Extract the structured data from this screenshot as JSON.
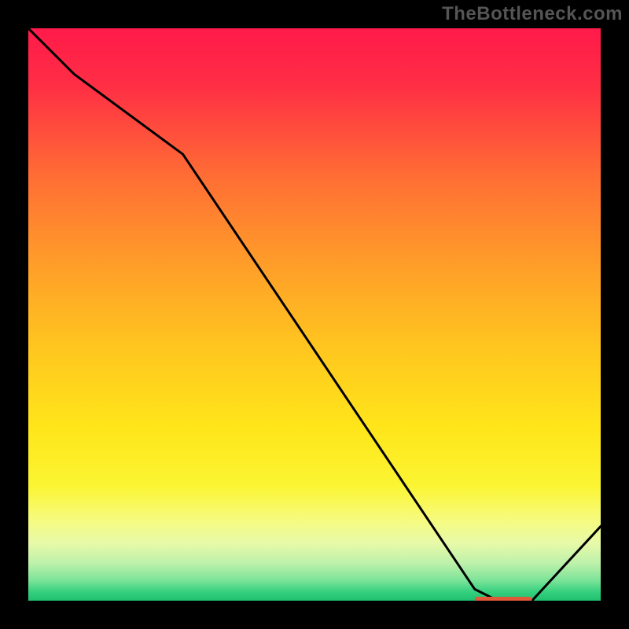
{
  "watermark": "TheBottleneck.com",
  "chart_data": {
    "type": "line",
    "title": "",
    "xlabel": "",
    "ylabel": "",
    "xlim": [
      0,
      100
    ],
    "ylim": [
      0,
      100
    ],
    "grid": false,
    "series": [
      {
        "name": "bottleneck-curve",
        "color": "#000000",
        "x": [
          0,
          8,
          27,
          78,
          82,
          88,
          100
        ],
        "y": [
          100,
          92,
          78,
          2,
          0,
          0,
          13
        ]
      }
    ],
    "optimal_marker": {
      "x_range": [
        78,
        88
      ],
      "y": 0,
      "color": "#e05a3a"
    },
    "background_gradient": {
      "stops": [
        {
          "pos": 0.0,
          "color": "#ff1a4a"
        },
        {
          "pos": 0.1,
          "color": "#ff2e45"
        },
        {
          "pos": 0.25,
          "color": "#ff6a35"
        },
        {
          "pos": 0.4,
          "color": "#ff9a2a"
        },
        {
          "pos": 0.55,
          "color": "#ffc41f"
        },
        {
          "pos": 0.7,
          "color": "#ffe61a"
        },
        {
          "pos": 0.8,
          "color": "#fbf533"
        },
        {
          "pos": 0.86,
          "color": "#f6fb80"
        },
        {
          "pos": 0.9,
          "color": "#e7faa9"
        },
        {
          "pos": 0.935,
          "color": "#bdf1aa"
        },
        {
          "pos": 0.965,
          "color": "#7ae398"
        },
        {
          "pos": 0.985,
          "color": "#34d07e"
        },
        {
          "pos": 1.0,
          "color": "#1fc06f"
        }
      ]
    }
  }
}
